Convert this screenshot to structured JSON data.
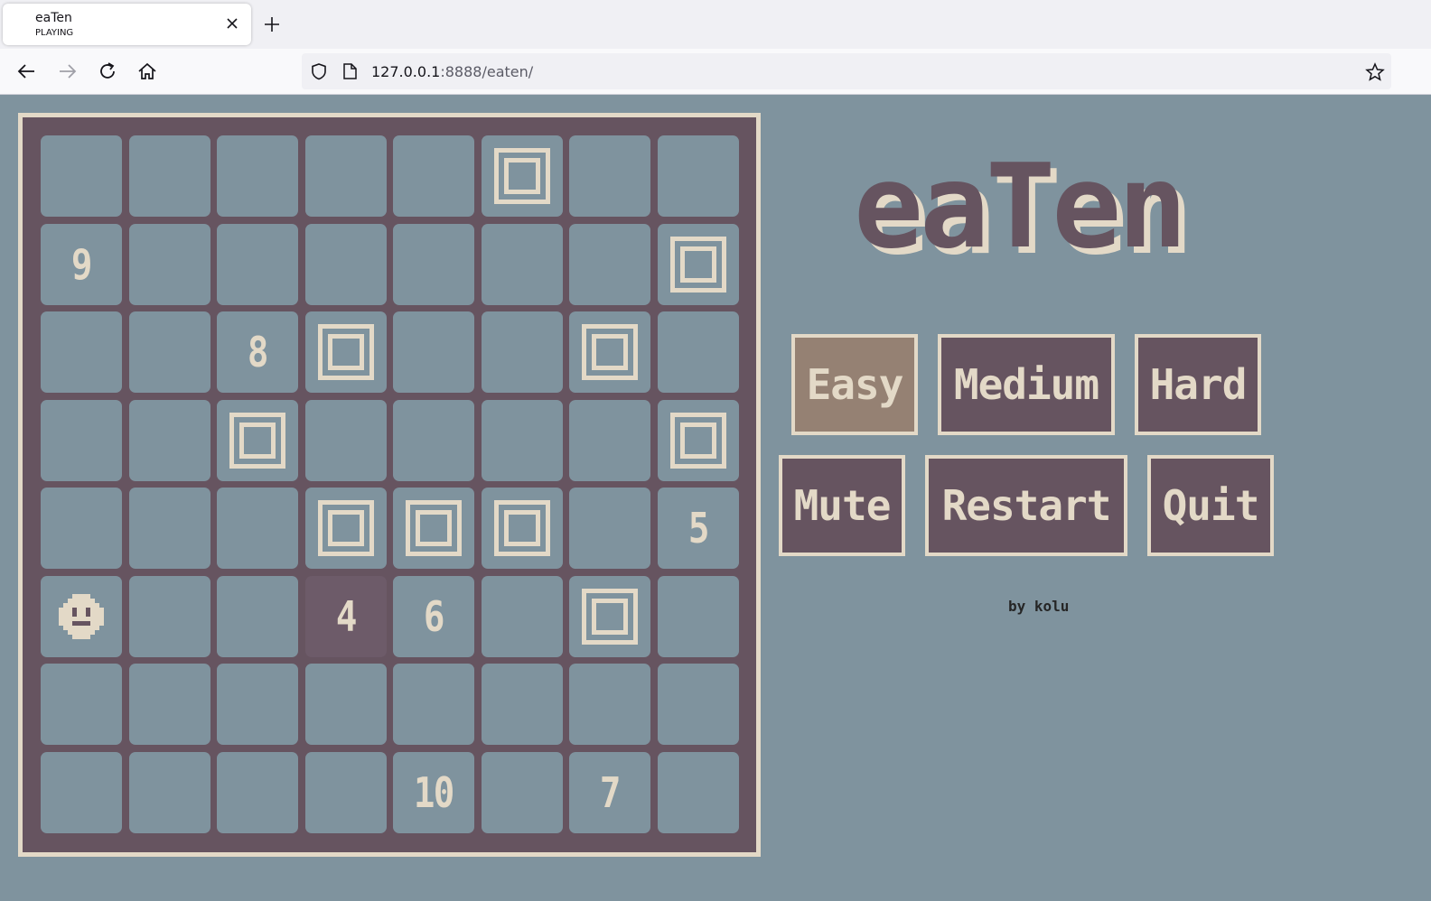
{
  "browser": {
    "tab_title": "eaTen",
    "tab_subtitle": "PLAYING",
    "url_host": "127.0.0.1",
    "url_path": ":8888/eaten/"
  },
  "game": {
    "title": "eaTen",
    "credit": "by kolu",
    "buttons": {
      "easy": "Easy",
      "medium": "Medium",
      "hard": "Hard",
      "mute": "Mute",
      "restart": "Restart",
      "quit": "Quit"
    },
    "active_difficulty": "Easy",
    "grid_size": 8,
    "grid": [
      [
        ".",
        ".",
        ".",
        ".",
        ".",
        "W",
        ".",
        "."
      ],
      [
        "9",
        ".",
        ".",
        ".",
        ".",
        ".",
        ".",
        "W"
      ],
      [
        ".",
        ".",
        "8",
        "W",
        ".",
        ".",
        "W",
        "."
      ],
      [
        ".",
        ".",
        "W",
        ".",
        ".",
        ".",
        ".",
        "W"
      ],
      [
        ".",
        ".",
        ".",
        "W",
        "W",
        "W",
        ".",
        "5"
      ],
      [
        "P",
        ".",
        ".",
        "4*",
        "6",
        ".",
        "W",
        "."
      ],
      [
        ".",
        ".",
        ".",
        ".",
        ".",
        ".",
        ".",
        "."
      ],
      [
        ".",
        ".",
        ".",
        ".",
        "10",
        ".",
        "7",
        "."
      ]
    ],
    "legend": {
      "W": "wall",
      "P": "player",
      "*": "eaten"
    },
    "colors": {
      "background": "#7f939e",
      "board": "#665460",
      "cream": "#e3d9c7",
      "active_button": "#958173"
    }
  }
}
